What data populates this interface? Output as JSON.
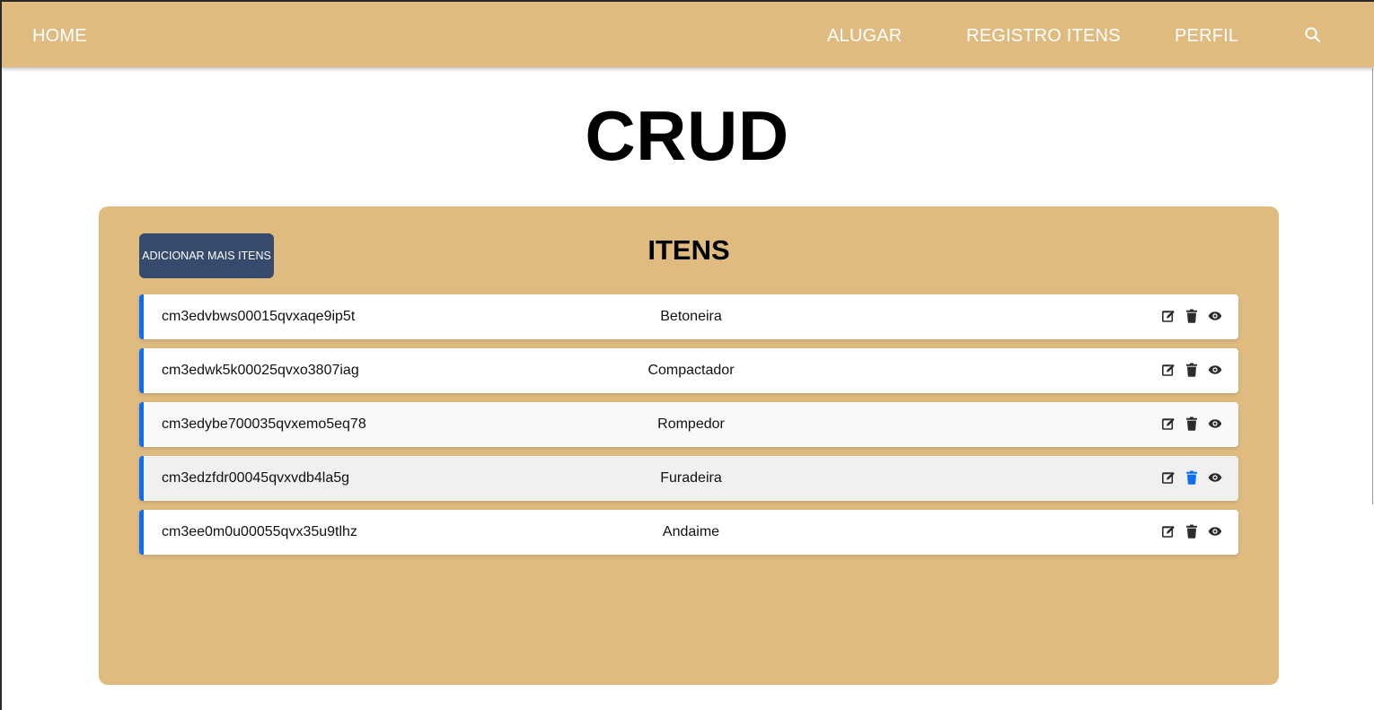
{
  "nav": {
    "home": "HOME",
    "alugar": "ALUGAR",
    "registro": "REGISTRO ITENS",
    "perfil": "PERFIL",
    "search_icon": "search-icon"
  },
  "page": {
    "title": "CRUD"
  },
  "panel": {
    "title": "ITENS",
    "add_button": "ADICIONAR MAIS ITENS"
  },
  "items": [
    {
      "id": "cm3edvbws00015qvxaqe9ip5t",
      "name": "Betoneira"
    },
    {
      "id": "cm3edwk5k00025qvxo3807iag",
      "name": "Compactador"
    },
    {
      "id": "cm3edybe700035qvxemo5eq78",
      "name": "Rompedor"
    },
    {
      "id": "cm3edzfdr00045qvxvdb4la5g",
      "name": "Furadeira"
    },
    {
      "id": "cm3ee0m0u00055qvx35u9tlhz",
      "name": "Andaime"
    }
  ],
  "icons": {
    "edit": "edit-icon",
    "delete": "trash-icon",
    "view": "eye-icon"
  },
  "colors": {
    "nav_bg": "#e0bb80",
    "panel_bg": "#e0bb80",
    "button_bg": "#354a6c",
    "accent": "#0b6ff0",
    "icon": "#2b2b2b"
  }
}
